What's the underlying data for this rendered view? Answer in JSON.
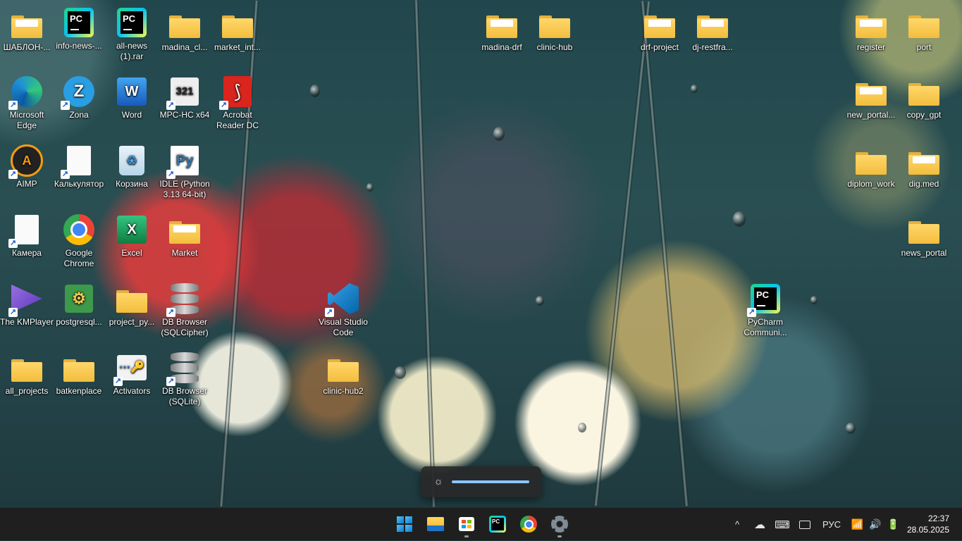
{
  "desktop": {
    "icons": [
      {
        "label": "ШАБЛОН-...",
        "icon": "folder-icon"
      },
      {
        "label": "info-news-...",
        "icon": "pycharm-icon"
      },
      {
        "label": "all-news (1).rar",
        "icon": "pycharm-icon"
      },
      {
        "label": "madina_cl...",
        "icon": "folder-icon"
      },
      {
        "label": "market_int...",
        "icon": "folder-icon"
      },
      {
        "label": "madina-drf",
        "icon": "folder-icon"
      },
      {
        "label": "clinic-hub",
        "icon": "folder-icon"
      },
      {
        "label": "drf-project",
        "icon": "folder-icon"
      },
      {
        "label": "dj-restfra...",
        "icon": "folder-icon"
      },
      {
        "label": "register",
        "icon": "folder-icon"
      },
      {
        "label": "port",
        "icon": "folder-icon"
      },
      {
        "label": "Microsoft Edge",
        "icon": "edge-icon"
      },
      {
        "label": "Zona",
        "icon": "zona-icon"
      },
      {
        "label": "Word",
        "icon": "word-icon"
      },
      {
        "label": "MPC-HC x64",
        "icon": "mpc-hc-icon"
      },
      {
        "label": "Acrobat Reader DC",
        "icon": "acrobat-icon"
      },
      {
        "label": "new_portal...",
        "icon": "folder-icon"
      },
      {
        "label": "copy_gpt",
        "icon": "folder-icon"
      },
      {
        "label": "AIMP",
        "icon": "aimp-icon"
      },
      {
        "label": "Калькулятор",
        "icon": "document-icon"
      },
      {
        "label": "Корзина",
        "icon": "recycle-bin-icon"
      },
      {
        "label": "IDLE (Python 3.13 64-bit)",
        "icon": "python-idle-icon"
      },
      {
        "label": "diplom_work",
        "icon": "folder-icon"
      },
      {
        "label": "dig.med",
        "icon": "folder-icon"
      },
      {
        "label": "Камера",
        "icon": "document-icon"
      },
      {
        "label": "Google Chrome",
        "icon": "chrome-icon"
      },
      {
        "label": "Excel",
        "icon": "excel-icon"
      },
      {
        "label": "Market",
        "icon": "folder-icon"
      },
      {
        "label": "news_portal",
        "icon": "folder-icon"
      },
      {
        "label": "The KMPlayer",
        "icon": "kmplayer-icon"
      },
      {
        "label": "postgresql...",
        "icon": "postgresql-icon"
      },
      {
        "label": "project_py...",
        "icon": "folder-icon"
      },
      {
        "label": "DB Browser (SQLCipher)",
        "icon": "database-icon"
      },
      {
        "label": "Visual Studio Code",
        "icon": "vscode-icon"
      },
      {
        "label": "PyCharm Communi...",
        "icon": "pycharm-icon"
      },
      {
        "label": "all_projects",
        "icon": "folder-icon"
      },
      {
        "label": "batkenplace",
        "icon": "folder-icon"
      },
      {
        "label": "Activators",
        "icon": "activators-icon"
      },
      {
        "label": "DB Browser (SQLite)",
        "icon": "database-icon"
      },
      {
        "label": "clinic-hub2",
        "icon": "folder-icon"
      }
    ]
  },
  "brightness_flyout": {
    "icon": "brightness-icon",
    "level": 1.0,
    "accent": "#8ac6ff"
  },
  "taskbar": {
    "apps": [
      {
        "name": "start-button",
        "icon": "windows-logo-icon"
      },
      {
        "name": "file-explorer",
        "icon": "folder-icon"
      },
      {
        "name": "microsoft-store",
        "icon": "store-icon"
      },
      {
        "name": "pycharm",
        "icon": "pycharm-icon"
      },
      {
        "name": "chrome",
        "icon": "chrome-icon"
      },
      {
        "name": "settings",
        "icon": "gear-icon"
      }
    ],
    "tray": {
      "chevron": "^",
      "language": "РУС",
      "icons": [
        "chevron-up-icon",
        "onedrive-icon",
        "keyboard-icon",
        "tablet-mode-icon",
        "wifi-icon",
        "volume-icon",
        "battery-icon"
      ]
    },
    "clock": {
      "time": "22:37",
      "date": "28.05.2025"
    }
  },
  "colors": {
    "taskbar": "#1f1f1f",
    "folder": "#f3bd3d",
    "accent": "#8ac6ff"
  }
}
